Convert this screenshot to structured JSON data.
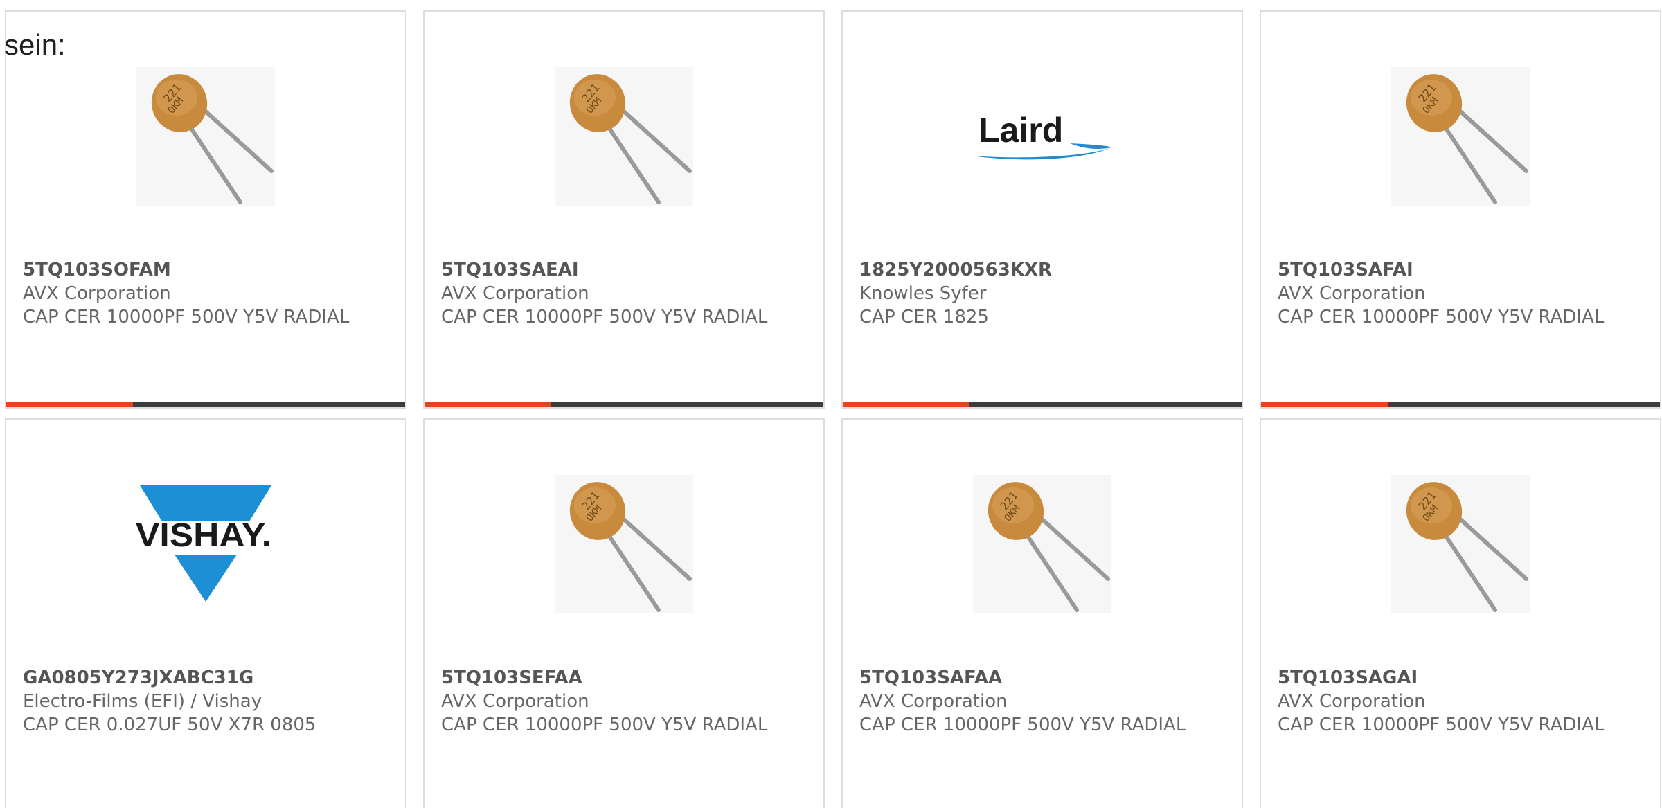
{
  "intro_text": "sein:",
  "colors": {
    "accent": "#e8431a",
    "bar": "#3c3c3c",
    "border": "#dddddd",
    "text": "#666666",
    "laird_blue": "#1f8ad1",
    "vishay_blue": "#1d8fd4",
    "capacitor_body": "#c88a3c"
  },
  "products": [
    {
      "image": "ceramic-capacitor-image",
      "part_number": "5TQ103SOFAM",
      "manufacturer": "AVX Corporation",
      "description": "CAP CER 10000PF 500V Y5V RADIAL"
    },
    {
      "image": "ceramic-capacitor-image",
      "part_number": "5TQ103SAEAI",
      "manufacturer": "AVX Corporation",
      "description": "CAP CER 10000PF 500V Y5V RADIAL"
    },
    {
      "image": "laird-logo",
      "logo_text": "Laird",
      "part_number": "1825Y2000563KXR",
      "manufacturer": "Knowles Syfer",
      "description": "CAP CER 1825"
    },
    {
      "image": "ceramic-capacitor-image",
      "part_number": "5TQ103SAFAI",
      "manufacturer": "AVX Corporation",
      "description": "CAP CER 10000PF 500V Y5V RADIAL"
    },
    {
      "image": "vishay-logo",
      "logo_text": "VISHAY.",
      "part_number": "GA0805Y273JXABC31G",
      "manufacturer": "Electro-Films (EFI) / Vishay",
      "description": "CAP CER 0.027UF 50V X7R 0805"
    },
    {
      "image": "ceramic-capacitor-image",
      "part_number": "5TQ103SEFAA",
      "manufacturer": "AVX Corporation",
      "description": "CAP CER 10000PF 500V Y5V RADIAL"
    },
    {
      "image": "ceramic-capacitor-image",
      "part_number": "5TQ103SAFAA",
      "manufacturer": "AVX Corporation",
      "description": "CAP CER 10000PF 500V Y5V RADIAL"
    },
    {
      "image": "ceramic-capacitor-image",
      "part_number": "5TQ103SAGAI",
      "manufacturer": "AVX Corporation",
      "description": "CAP CER 10000PF 500V Y5V RADIAL"
    }
  ]
}
